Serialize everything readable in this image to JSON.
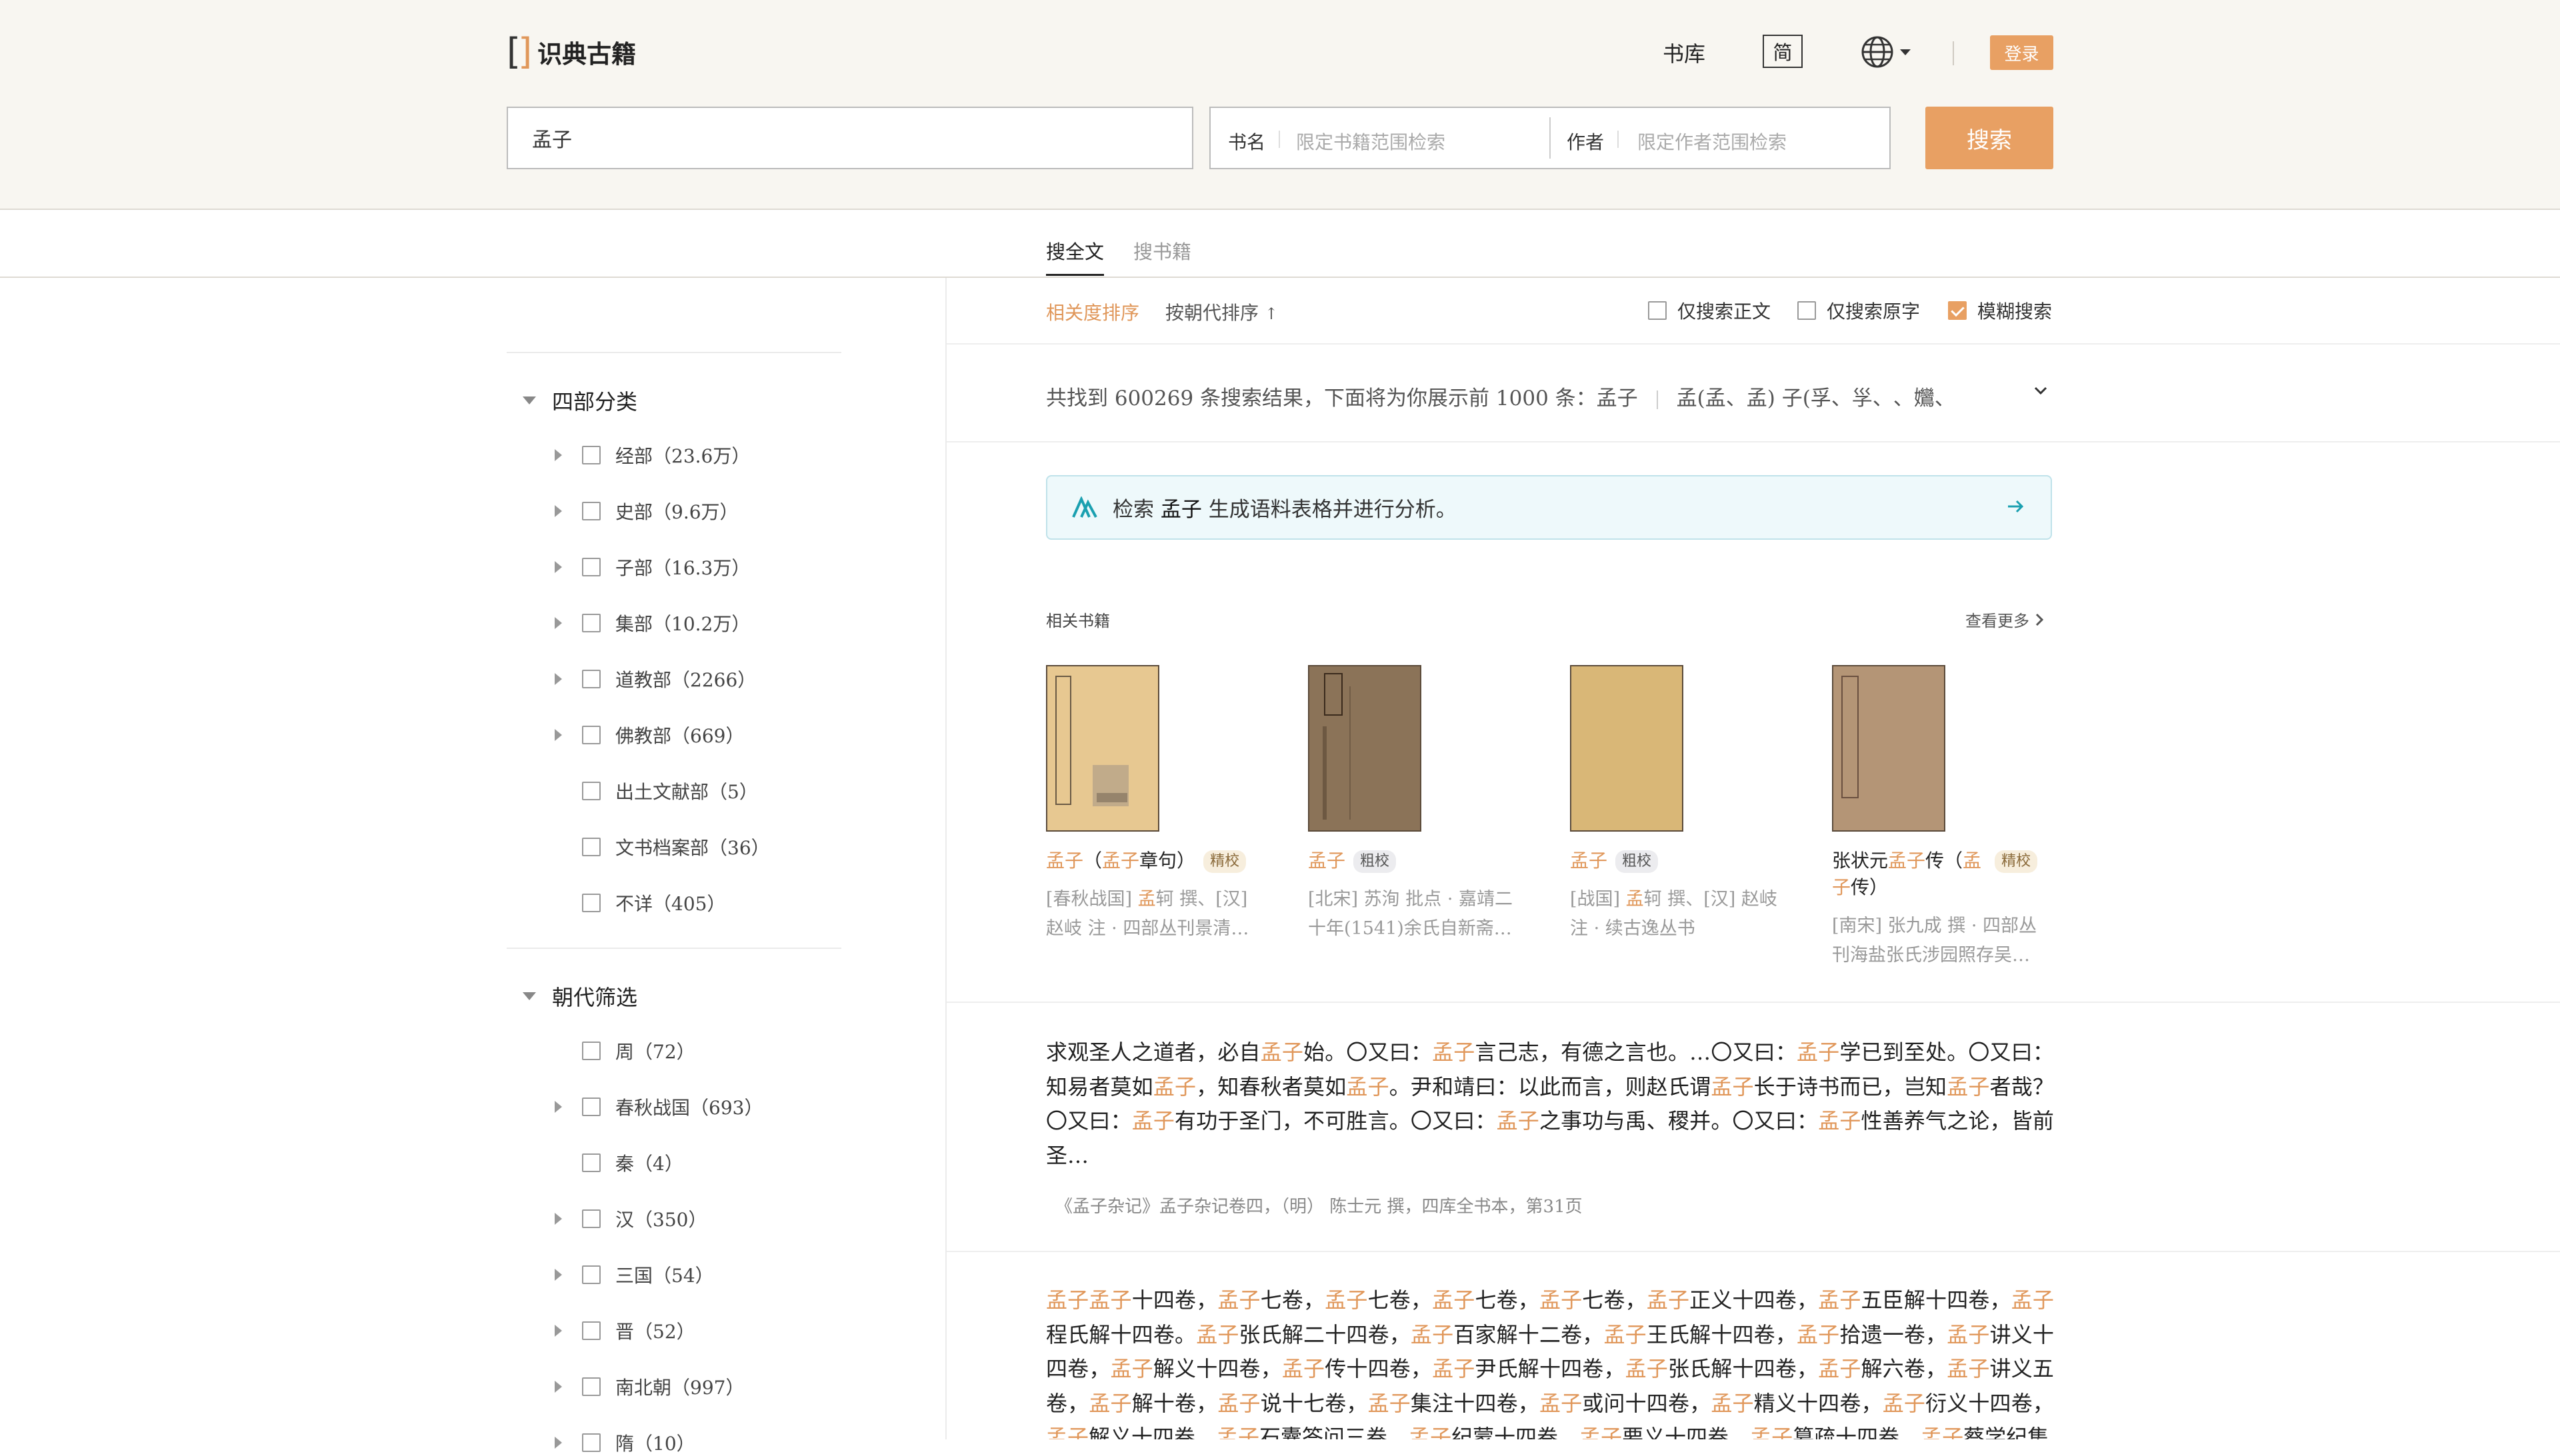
{
  "header": {
    "logo_mark": "[]",
    "logo_text": "识典古籍",
    "nav_library": "书库",
    "lang_toggle": "简",
    "login": "登录"
  },
  "search": {
    "query": "孟子",
    "book_label": "书名",
    "book_placeholder": "限定书籍范围检索",
    "author_label": "作者",
    "author_placeholder": "限定作者范围检索",
    "button": "搜索"
  },
  "tabs": [
    "搜全文",
    "搜书籍"
  ],
  "sort": {
    "relevance": "相关度排序",
    "dynasty": "按朝代排序",
    "dynasty_arrow": "↑"
  },
  "options": [
    {
      "label": "仅搜索正文",
      "checked": false
    },
    {
      "label": "仅搜索原字",
      "checked": false
    },
    {
      "label": "模糊搜索",
      "checked": true
    }
  ],
  "summary": {
    "text": "共找到 600269 条搜索结果，下面将为你展示前 1000 条：孟子",
    "variants": "孟(孟、孟) 子(孚、㜽、𡥀、𡤻、"
  },
  "ai_banner": {
    "prefix": "检索",
    "keyword": "孟子",
    "suffix": "生成语料表格并进行分析。"
  },
  "sidebar": {
    "sections": [
      {
        "title": "四部分类",
        "items": [
          {
            "label": "经部（23.6万）",
            "expandable": true
          },
          {
            "label": "史部（9.6万）",
            "expandable": true
          },
          {
            "label": "子部（16.3万）",
            "expandable": true
          },
          {
            "label": "集部（10.2万）",
            "expandable": true
          },
          {
            "label": "道教部（2266）",
            "expandable": true
          },
          {
            "label": "佛教部（669）",
            "expandable": true
          },
          {
            "label": "出土文献部（5）",
            "expandable": false
          },
          {
            "label": "文书档案部（36）",
            "expandable": false
          },
          {
            "label": "不详（405）",
            "expandable": false
          }
        ]
      },
      {
        "title": "朝代筛选",
        "items": [
          {
            "label": "周（72）",
            "expandable": false
          },
          {
            "label": "春秋战国（693）",
            "expandable": true
          },
          {
            "label": "秦（4）",
            "expandable": false
          },
          {
            "label": "汉（350）",
            "expandable": true
          },
          {
            "label": "三国（54）",
            "expandable": true
          },
          {
            "label": "晋（52）",
            "expandable": true
          },
          {
            "label": "南北朝（997）",
            "expandable": true
          },
          {
            "label": "隋（10）",
            "expandable": true
          }
        ]
      }
    ]
  },
  "related": {
    "title": "相关书籍",
    "more": "查看更多",
    "books": [
      {
        "t1": "孟子",
        "t2": "（",
        "t3": "孟子",
        "t4": "章句）",
        "badge": "精校",
        "meta1": "[春秋战国] ",
        "meta_hl": "孟",
        "meta2": "轲 撰、[汉]",
        "meta3": "赵岐 注 · 四部丛刊景清…",
        "cover": "#e8c98e"
      },
      {
        "t1": "孟子",
        "badge": "粗校",
        "meta1": "[北宋] 苏洵 批点 · 嘉靖二",
        "meta3": "十年(1541)余氏自新斋…",
        "cover": "#8a735a"
      },
      {
        "t1": "孟子",
        "badge": "粗校",
        "meta1": "[战国] ",
        "meta_hl": "孟",
        "meta2": "轲 撰、[汉] 赵岐",
        "meta3": "注 · 续古逸丛书",
        "cover": "#d8b777"
      },
      {
        "t1": "张状元",
        "t2": "孟子",
        "t3": "传（",
        "t4": "孟",
        "t5": "子",
        "t6": "传）",
        "badge": "精校",
        "meta1": "[南宋] 张九成 撰 · 四部丛",
        "meta3": "刊海盐张氏涉园照存吴…",
        "cover": "#b59575"
      }
    ]
  },
  "results": [
    {
      "segments": [
        {
          "t": "求观圣人之道者，必自",
          "hl": false
        },
        {
          "t": "孟子",
          "hl": true
        },
        {
          "t": "始。〇又曰：",
          "hl": false
        },
        {
          "t": "孟子",
          "hl": true
        },
        {
          "t": "言己志，有德之言也。…〇又曰：",
          "hl": false
        },
        {
          "t": "孟子",
          "hl": true
        },
        {
          "t": "学已到至处。〇又曰：知易者莫如",
          "hl": false
        },
        {
          "t": "孟子",
          "hl": true
        },
        {
          "t": "，知春秋者莫如",
          "hl": false
        },
        {
          "t": "孟子",
          "hl": true
        },
        {
          "t": "。尹和靖曰：以此而言，则赵氏谓",
          "hl": false
        },
        {
          "t": "孟子",
          "hl": true
        },
        {
          "t": "长于诗书而已，岂知",
          "hl": false
        },
        {
          "t": "孟子",
          "hl": true
        },
        {
          "t": "者哉？〇又曰：",
          "hl": false
        },
        {
          "t": "孟子",
          "hl": true
        },
        {
          "t": "有功于圣门，不可胜言。〇又曰：",
          "hl": false
        },
        {
          "t": "孟子",
          "hl": true
        },
        {
          "t": "之事功与禹、稷并。〇又曰：",
          "hl": false
        },
        {
          "t": "孟子",
          "hl": true
        },
        {
          "t": "性善养气之论，皆前圣…",
          "hl": false
        }
      ],
      "source": "《孟子杂记》孟子杂记卷四，（明） 陈士元 撰，四库全书本，第31页"
    },
    {
      "segments": [
        {
          "t": "孟子孟子",
          "hl": true
        },
        {
          "t": "十四卷，",
          "hl": false
        },
        {
          "t": "孟子",
          "hl": true
        },
        {
          "t": "七卷，",
          "hl": false
        },
        {
          "t": "孟子",
          "hl": true
        },
        {
          "t": "七卷，",
          "hl": false
        },
        {
          "t": "孟子",
          "hl": true
        },
        {
          "t": "七卷，",
          "hl": false
        },
        {
          "t": "孟子",
          "hl": true
        },
        {
          "t": "七卷，",
          "hl": false
        },
        {
          "t": "孟子",
          "hl": true
        },
        {
          "t": "正义十四卷，",
          "hl": false
        },
        {
          "t": "孟子",
          "hl": true
        },
        {
          "t": "五臣解十四卷，",
          "hl": false
        },
        {
          "t": "孟子",
          "hl": true
        },
        {
          "t": "程氏解十四卷。",
          "hl": false
        },
        {
          "t": "孟子",
          "hl": true
        },
        {
          "t": "张氏解二十四卷，",
          "hl": false
        },
        {
          "t": "孟子",
          "hl": true
        },
        {
          "t": "百家解十二卷，",
          "hl": false
        },
        {
          "t": "孟子",
          "hl": true
        },
        {
          "t": "王氏解十四卷，",
          "hl": false
        },
        {
          "t": "孟子",
          "hl": true
        },
        {
          "t": "拾遗一卷，",
          "hl": false
        },
        {
          "t": "孟子",
          "hl": true
        },
        {
          "t": "讲义十四卷，",
          "hl": false
        },
        {
          "t": "孟子",
          "hl": true
        },
        {
          "t": "解义十四卷，",
          "hl": false
        },
        {
          "t": "孟子",
          "hl": true
        },
        {
          "t": "传十四卷，",
          "hl": false
        },
        {
          "t": "孟子",
          "hl": true
        },
        {
          "t": "尹氏解十四卷，",
          "hl": false
        },
        {
          "t": "孟子",
          "hl": true
        },
        {
          "t": "张氏解十四卷，",
          "hl": false
        },
        {
          "t": "孟子",
          "hl": true
        },
        {
          "t": "解六卷，",
          "hl": false
        },
        {
          "t": "孟子",
          "hl": true
        },
        {
          "t": "讲义五卷，",
          "hl": false
        },
        {
          "t": "孟子",
          "hl": true
        },
        {
          "t": "解十卷，",
          "hl": false
        },
        {
          "t": "孟子",
          "hl": true
        },
        {
          "t": "说十七卷，",
          "hl": false
        },
        {
          "t": "孟子",
          "hl": true
        },
        {
          "t": "集注十四卷，",
          "hl": false
        },
        {
          "t": "孟子",
          "hl": true
        },
        {
          "t": "或问十四卷，",
          "hl": false
        },
        {
          "t": "孟子",
          "hl": true
        },
        {
          "t": "精义十四卷，",
          "hl": false
        },
        {
          "t": "孟子",
          "hl": true
        },
        {
          "t": "衍义十四卷，",
          "hl": false
        },
        {
          "t": "孟子",
          "hl": true
        },
        {
          "t": "解义十四卷，",
          "hl": false
        },
        {
          "t": "孟子",
          "hl": true
        },
        {
          "t": "石囊答问三卷，",
          "hl": false
        },
        {
          "t": "孟子",
          "hl": true
        },
        {
          "t": "纪蒙十四卷，",
          "hl": false
        },
        {
          "t": "孟子",
          "hl": true
        },
        {
          "t": "要义十四卷，",
          "hl": false
        },
        {
          "t": "孟子",
          "hl": true
        },
        {
          "t": "篡疏十四卷，",
          "hl": false
        },
        {
          "t": "孟子",
          "hl": true
        },
        {
          "t": "蔡学纪集",
          "hl": false
        }
      ]
    }
  ],
  "colors": {
    "accent": "#e8a063",
    "highlight_text": "#e0975a",
    "header_bg": "#f8f6f1",
    "banner_bg": "#eef9fb"
  }
}
